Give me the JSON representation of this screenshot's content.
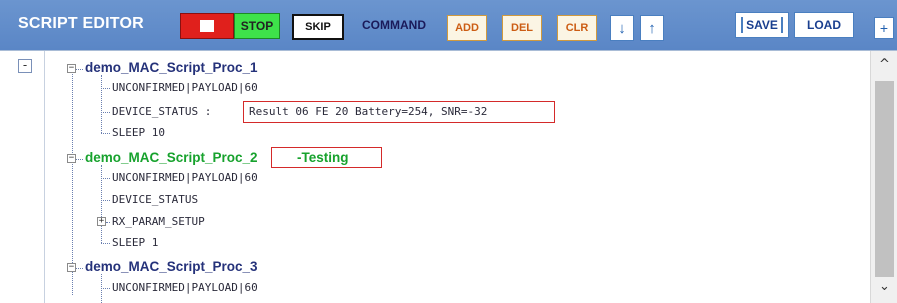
{
  "header": {
    "title": "SCRIPT EDITOR",
    "stop_label": "STOP",
    "skip_label": "SKIP",
    "command_label": "COMMAND",
    "add_label": "ADD",
    "del_label": "DEL",
    "clr_label": "CLR",
    "down_arrow": "↓",
    "up_arrow": "↑",
    "save_label": "SAVE",
    "load_label": "LOAD",
    "plus_label": "+"
  },
  "tree": {
    "collapse_all": "-",
    "procs": [
      {
        "name": "demo_MAC_Script_Proc_1",
        "children": [
          "UNCONFIRMED|PAYLOAD|60",
          "DEVICE_STATUS :",
          "SLEEP 10"
        ],
        "result": "Result 06 FE 20 Battery=254, SNR=-32"
      },
      {
        "name": "demo_MAC_Script_Proc_2",
        "status": "-Testing",
        "children": [
          "UNCONFIRMED|PAYLOAD|60",
          "DEVICE_STATUS",
          "RX_PARAM_SETUP",
          "SLEEP 1"
        ]
      },
      {
        "name": "demo_MAC_Script_Proc_3",
        "children": [
          "UNCONFIRMED|PAYLOAD|60"
        ]
      }
    ],
    "expander_minus": "−",
    "expander_plus": "+"
  },
  "scrollbar": {
    "up": "^",
    "down": "⌄"
  },
  "colors": {
    "header_bg": "#5a86c6",
    "proc_running": "#17a22d",
    "proc_idle": "#25327a",
    "highlight_border": "#d42a2a"
  }
}
